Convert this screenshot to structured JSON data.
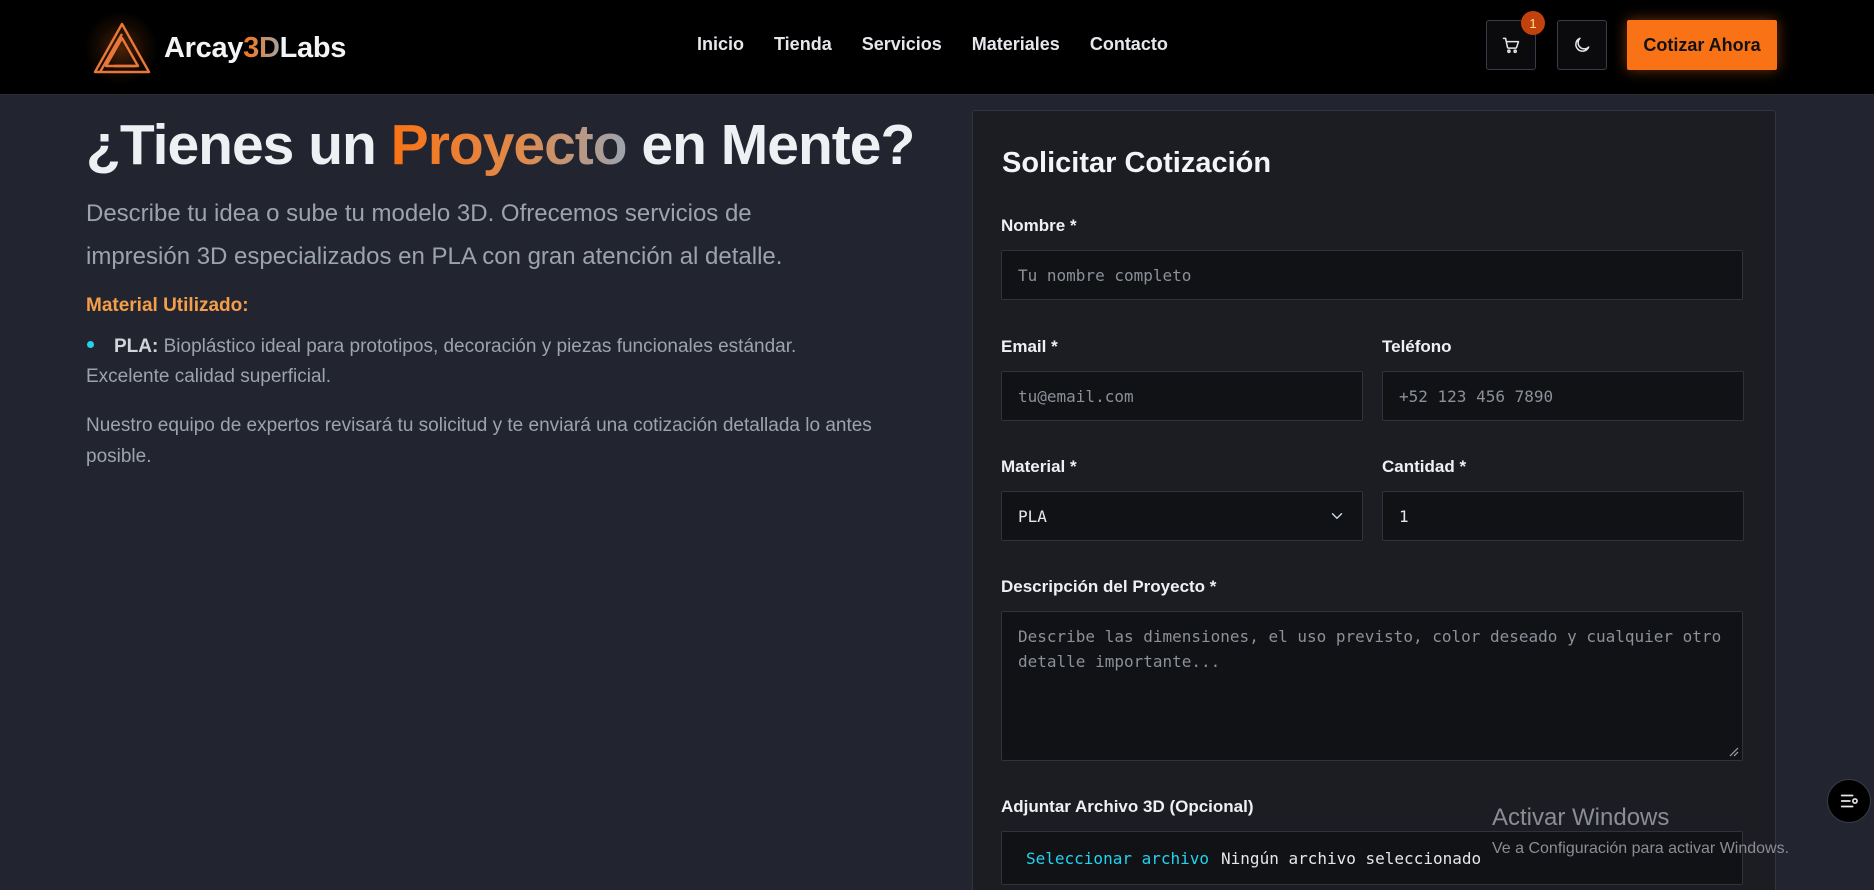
{
  "brand": {
    "name_part1": "Arcay",
    "name_part2": "3D",
    "name_part3": "Labs",
    "accent_color": "#f97316"
  },
  "nav": {
    "links": [
      "Inicio",
      "Tienda",
      "Servicios",
      "Materiales",
      "Contacto"
    ],
    "cart_count": "1",
    "cart_icon": "cart-icon",
    "theme_icon": "moon-icon",
    "cta_label": "Cotizar Ahora"
  },
  "hero": {
    "title_before": "¿Tienes un ",
    "title_accent": "Proyecto",
    "title_after": " en Mente?",
    "subtitle": "Describe tu idea o sube tu modelo 3D. Ofrecemos servicios de impresión 3D especializados en PLA con gran atención al detalle.",
    "material_heading": "Material Utilizado:",
    "material_name": "PLA:",
    "material_desc": " Bioplástico ideal para prototipos, decoración y piezas funcionales estándar. Excelente calidad superficial.",
    "team_note": "Nuestro equipo de expertos revisará tu solicitud y te enviará una cotización detallada lo antes posible."
  },
  "form": {
    "title": "Solicitar Cotización",
    "name_label": "Nombre *",
    "name_placeholder": "Tu nombre completo",
    "email_label": "Email *",
    "email_placeholder": "tu@email.com",
    "phone_label": "Teléfono",
    "phone_placeholder": "+52 123 456 7890",
    "material_label": "Material *",
    "material_value": "PLA",
    "quantity_label": "Cantidad *",
    "quantity_value": "1",
    "description_label": "Descripción del Proyecto *",
    "description_placeholder": "Describe las dimensiones, el uso previsto, color deseado y cualquier otro detalle importante...",
    "file_label": "Adjuntar Archivo 3D (Opcional)",
    "file_button": "Seleccionar archivo",
    "file_status": "Ningún archivo seleccionado"
  },
  "watermark": {
    "line1": "Activar Windows",
    "line2": "Ve a Configuración para activar Windows."
  }
}
